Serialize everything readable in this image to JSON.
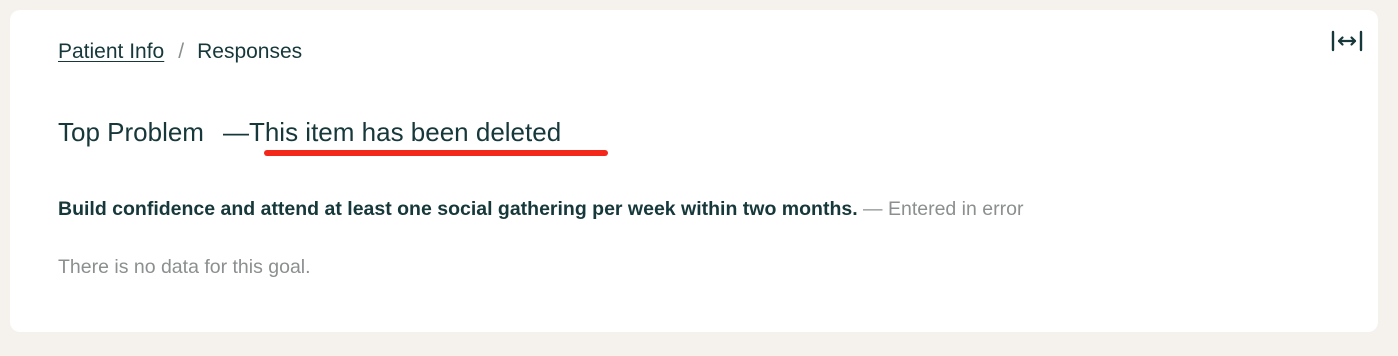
{
  "breadcrumb": {
    "parent_label": "Patient Info",
    "separator": "/",
    "current_label": "Responses"
  },
  "header": {
    "expand_icon": "expand-horizontal-icon"
  },
  "problem": {
    "title": "Top Problem",
    "dash": "—",
    "status": "This item has been deleted"
  },
  "goal": {
    "text": "Build confidence and attend at least one social gathering per week within two months.",
    "status": "— Entered in error",
    "empty_message": "There is no data for this goal."
  },
  "colors": {
    "page_background": "#f5f2ee",
    "card_background": "#ffffff",
    "text_primary": "#17383a",
    "text_muted": "#8c8f8f",
    "annotation": "#f4271b"
  }
}
